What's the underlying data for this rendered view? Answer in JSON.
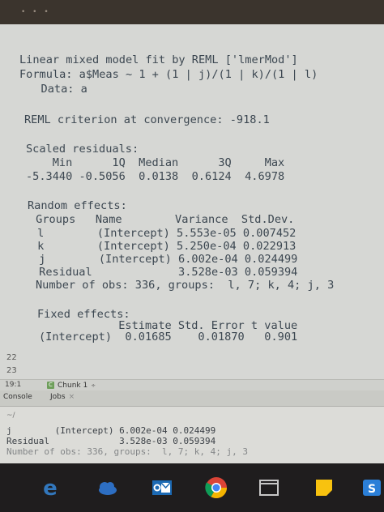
{
  "console": {
    "lines": [
      "Linear mixed model fit by REML ['lmerMod']",
      "Formula: a$Meas ~ 1 + (1 | j)/(1 | k)/(1 | l)",
      "   Data: a",
      "REML criterion at convergence: -918.1",
      "Scaled residuals:",
      "    Min      1Q  Median      3Q     Max",
      "-5.3440 -0.5056  0.0138  0.6124  4.6978",
      "Random effects:",
      " Groups   Name        Variance  Std.Dev.",
      " l        (Intercept) 5.553e-05 0.007452",
      " k        (Intercept) 5.250e-04 0.022913",
      " j        (Intercept) 6.002e-04 0.024499",
      " Residual             3.528e-03 0.059394",
      "Number of obs: 336, groups:  l, 7; k, 4; j, 3",
      "Fixed effects:",
      "            Estimate Std. Error t value",
      "(Intercept)  0.01685    0.01870   0.901"
    ]
  },
  "editor": {
    "line_numbers": [
      "22",
      "23"
    ],
    "cursor_position": "19:1",
    "chunk_label": "Chunk 1",
    "chunk_caret": "÷"
  },
  "lower_pane": {
    "tabs": {
      "console": "Console",
      "jobs": "Jobs",
      "jobs_close": "×"
    },
    "cwd": "~/",
    "lines": [
      "j        (Intercept) 6.002e-04 0.024499",
      "Residual             3.528e-03 0.059394",
      "Number of obs: 336, groups:  l, 7; k, 4; j, 3"
    ]
  },
  "taskbar": {
    "icons": [
      "edge-icon",
      "onedrive-icon",
      "outlook-icon",
      "chrome-icon",
      "window-icon",
      "sticky-notes-icon",
      "app-icon"
    ],
    "colors": {
      "edge": "#3277bc",
      "chrome_red": "#db4437",
      "chrome_yellow": "#f4b400",
      "chrome_green": "#0f9d58",
      "sticky": "#f8c20f",
      "outlook": "#1c6ab4"
    }
  }
}
